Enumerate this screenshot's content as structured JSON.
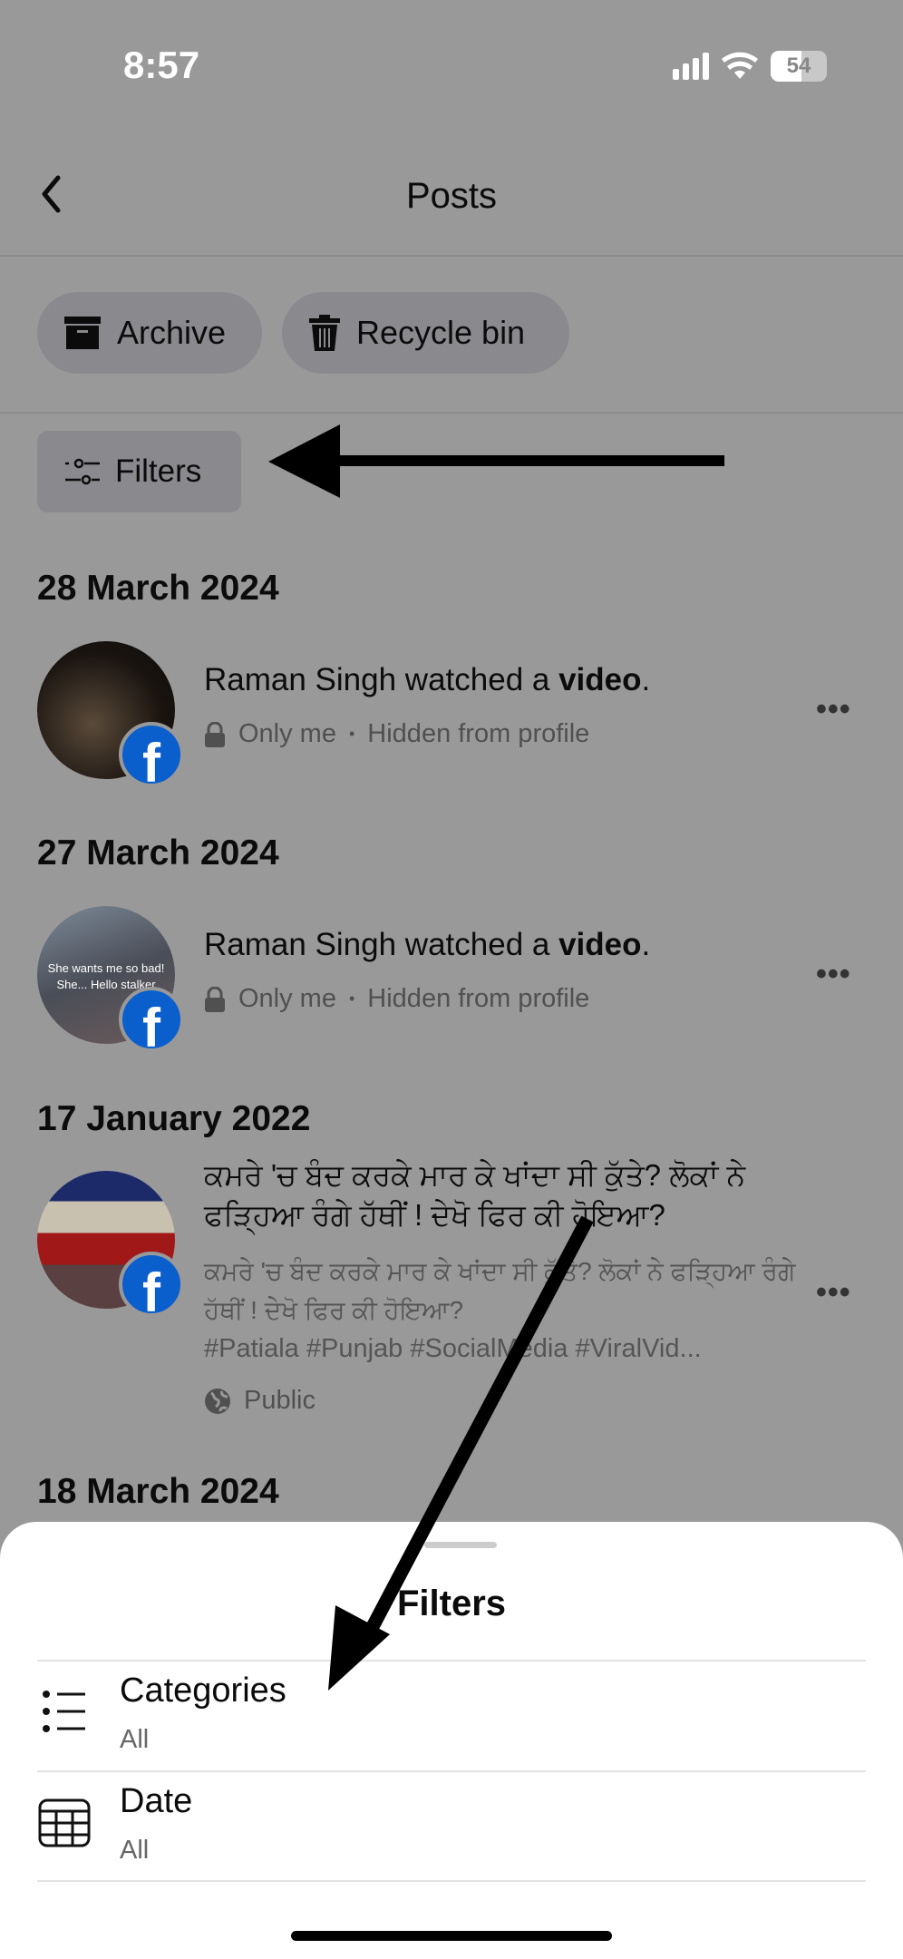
{
  "status_bar": {
    "time": "8:57",
    "battery": "54"
  },
  "nav": {
    "title": "Posts",
    "back_icon": "chevron-left-icon"
  },
  "actions": {
    "archive": "Archive",
    "recycle_bin": "Recycle bin"
  },
  "filters_button": "Filters",
  "posts": [
    {
      "date": "28 March 2024",
      "text_prefix": "Raman Singh watched a ",
      "text_bold": "video",
      "text_suffix": ".",
      "privacy": "Only me",
      "visibility": "Hidden from profile"
    },
    {
      "date": "27 March 2024",
      "text_prefix": "Raman Singh watched a ",
      "text_bold": "video",
      "text_suffix": ".",
      "privacy": "Only me",
      "visibility": "Hidden from profile",
      "thumb_text": "She wants me so bad! She... Hello stalker"
    },
    {
      "date": "17 January 2022",
      "title": "ਕਮਰੇ 'ਚ ਬੰਦ ਕਰਕੇ ਮਾਰ ਕੇ ਖਾਂਦਾ ਸੀ ਕੁੱਤੇ? ਲੋਕਾਂ ਨੇ ਫੜ੍ਹਿਆ ਰੰਗੇ ਹੱਥੀਂ ! ਦੇਖੋ ਫਿਰ ਕੀ ਹੋਇਆ?",
      "description": "ਕਮਰੇ 'ਚ ਬੰਦ ਕਰਕੇ ਮਾਰ ਕੇ ਖਾਂਦਾ ਸੀ ਕੁੱਤੇ? ਲੋਕਾਂ ਨੇ ਫੜ੍ਹਿਆ ਰੰਗੇ ਹੱਥੀਂ ! ਦੇਖੋ ਫਿਰ ਕੀ ਹੋਇਆ?",
      "hashtags": "#Patiala #Punjab #SocialMedia #ViralVid...",
      "privacy": "Public"
    },
    {
      "date": "18 March 2024"
    }
  ],
  "sheet": {
    "title": "Filters",
    "rows": [
      {
        "label": "Categories",
        "value": "All",
        "icon": "list-icon"
      },
      {
        "label": "Date",
        "value": "All",
        "icon": "calendar-icon"
      }
    ]
  },
  "separator": "•"
}
